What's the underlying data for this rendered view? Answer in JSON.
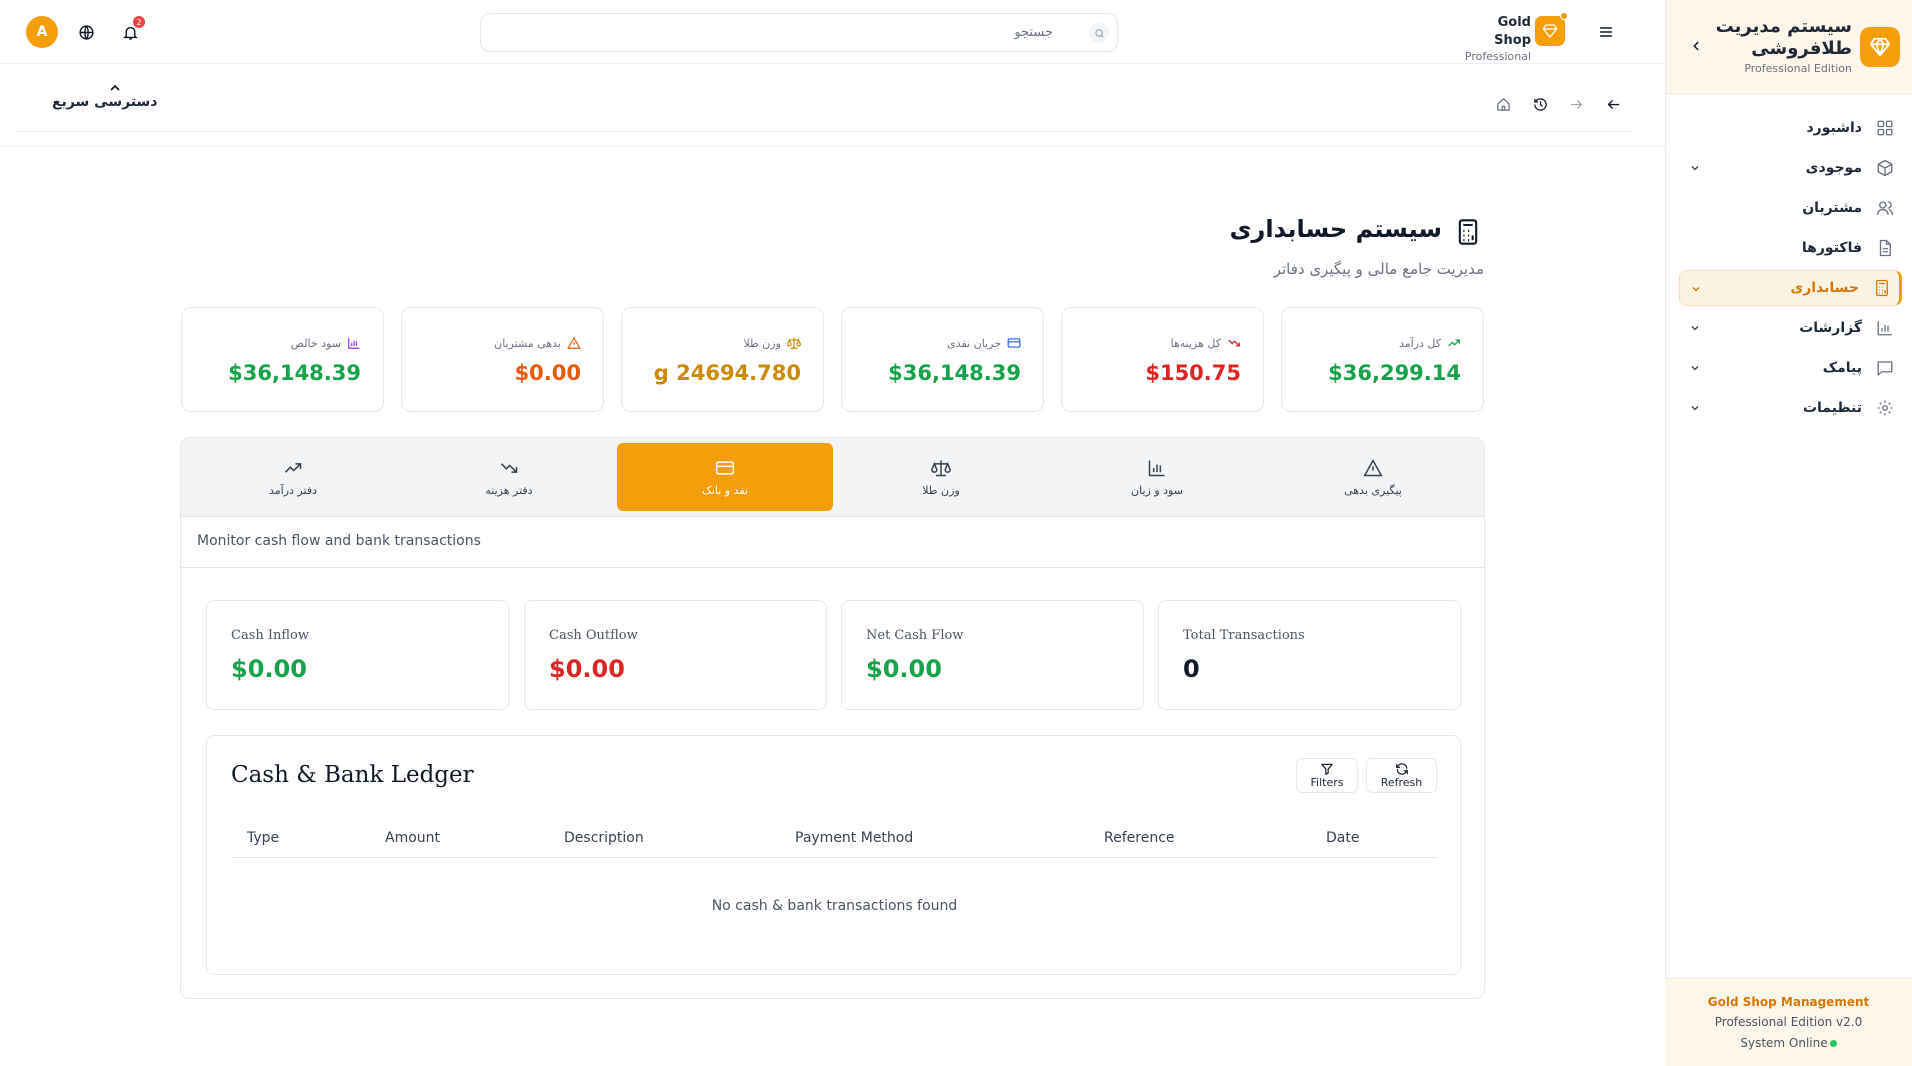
{
  "sidebar": {
    "title": "سیستم مدیریت طلافروشی",
    "edition": "Professional Edition",
    "items": [
      {
        "label": "داشبورد",
        "icon": "dashboard-icon"
      },
      {
        "label": "موجودی",
        "icon": "box-icon"
      },
      {
        "label": "مشتریان",
        "icon": "users-icon"
      },
      {
        "label": "فاکتورها",
        "icon": "invoice-icon"
      },
      {
        "label": "حسابداری",
        "icon": "calculator-icon"
      },
      {
        "label": "گزارشات",
        "icon": "bar-chart-icon"
      },
      {
        "label": "پیامک",
        "icon": "message-icon"
      },
      {
        "label": "تنظیمات",
        "icon": "gear-icon"
      }
    ],
    "footer": {
      "name": "Gold Shop Management",
      "version": "Professional Edition v2.0",
      "status": "System Online"
    }
  },
  "topbar": {
    "avatar_letter": "A",
    "notification_count": "2",
    "search_placeholder": "جستجو",
    "brand_name": "Gold Shop",
    "brand_edition": "Professional"
  },
  "breadcrumb": {
    "quick_access": "دسترسی سریع"
  },
  "page": {
    "title": "سیستم حسابداری",
    "subtitle": "مدیریت جامع مالی و پیگیری دفاتر"
  },
  "stats": [
    {
      "label": "کل درآمد",
      "value": "$36,299.14",
      "color": "#16a34a",
      "icon": "trend-up-icon"
    },
    {
      "label": "کل هزینه‌ها",
      "value": "$150.75",
      "color": "#dc2626",
      "icon": "trend-down-icon"
    },
    {
      "label": "جریان نقدی",
      "value": "$36,148.39",
      "color": "#16a34a",
      "icon": "credit-card-icon"
    },
    {
      "label": "وزن طلا",
      "value": "g 24694.780",
      "color": "#ca8a04",
      "icon": "scale-icon"
    },
    {
      "label": "بدهی مشتریان",
      "value": "$0.00",
      "color": "#ea580c",
      "icon": "warning-icon"
    },
    {
      "label": "سود خالص",
      "value": "$36,148.39",
      "color": "#16a34a",
      "icon": "bar-chart-icon"
    }
  ],
  "tabs": [
    {
      "label": "پیگیری بدهی"
    },
    {
      "label": "سود و زیان"
    },
    {
      "label": "وزن طلا"
    },
    {
      "label": "نقد و بانک"
    },
    {
      "label": "دفتر هزینه"
    },
    {
      "label": "دفتر درآمد"
    }
  ],
  "active_tab": "نقد و بانک",
  "panel": {
    "description": "Monitor cash flow and bank transactions",
    "summary": [
      {
        "label": "Cash Inflow",
        "value": "$0.00",
        "color": "#16a34a"
      },
      {
        "label": "Cash Outflow",
        "value": "$0.00",
        "color": "#dc2626"
      },
      {
        "label": "Net Cash Flow",
        "value": "$0.00",
        "color": "#16a34a"
      },
      {
        "label": "Total Transactions",
        "value": "0",
        "color": "#111827"
      }
    ],
    "ledger": {
      "title": "Cash & Bank Ledger",
      "filters_label": "Filters",
      "refresh_label": "Refresh",
      "columns": [
        "Type",
        "Amount",
        "Description",
        "Payment Method",
        "Reference",
        "Date"
      ],
      "empty_text": "No cash & bank transactions found"
    }
  },
  "colors": {
    "accent": "#f59e0b",
    "accent_dark": "#d97706",
    "positive": "#16a34a",
    "negative": "#dc2626"
  }
}
